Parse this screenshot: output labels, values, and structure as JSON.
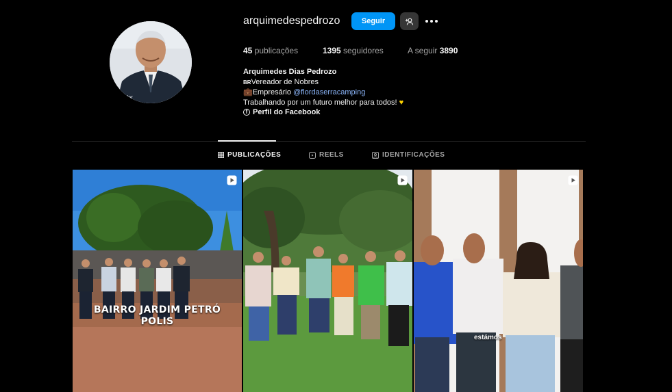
{
  "profile": {
    "username": "arquimedespedrozo",
    "follow_label": "Seguir",
    "stats": {
      "posts_count": "45",
      "posts_label": "publicações",
      "followers_count": "1395",
      "followers_label": "seguidores",
      "following_label": "A seguir",
      "following_count": "3890"
    },
    "bio": {
      "full_name": "Arquimedes Dias Pedrozo",
      "flag": "BR",
      "role": "Vereador de Nobres",
      "work_prefix": "Empresário",
      "mention": "@flordaserracamping",
      "tagline": "Trabalhando por um futuro melhor para todos!",
      "facebook_link": "Perfil do Facebook"
    }
  },
  "tabs": [
    {
      "label": "PUBLICAÇÕES",
      "icon": "grid-icon",
      "active": true
    },
    {
      "label": "REELS",
      "icon": "reels-icon",
      "active": false
    },
    {
      "label": "IDENTIFICAÇÕES",
      "icon": "tagged-icon",
      "active": false
    }
  ],
  "posts": [
    {
      "type": "reel",
      "overlay_text_line1": "BAIRRO JARDIM PETRÓ",
      "overlay_text_line2": "POLIS"
    },
    {
      "type": "reel"
    },
    {
      "type": "reel",
      "overlay_caption": "estámos"
    }
  ],
  "colors": {
    "background": "#000000",
    "follow_button": "#0095f6",
    "secondary_button": "#363636",
    "link": "#8ab4f8",
    "heart": "#ffd400"
  }
}
